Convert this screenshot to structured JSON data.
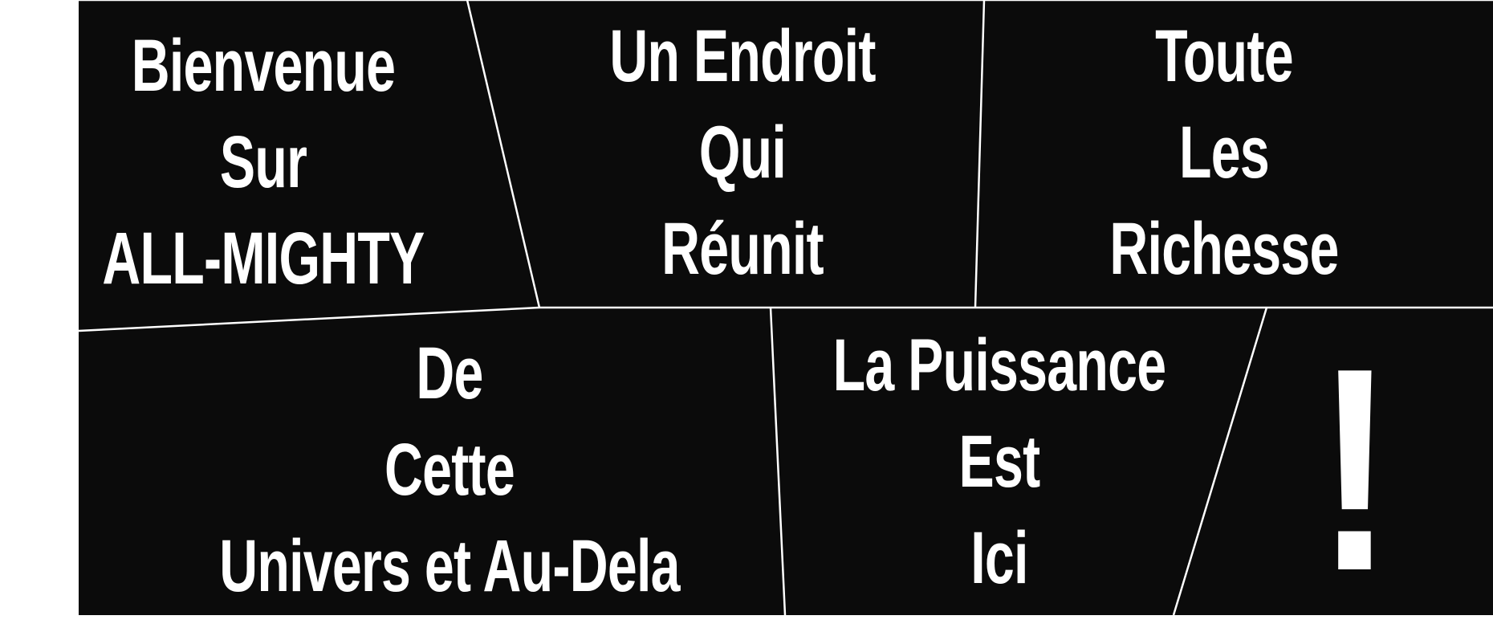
{
  "colors": {
    "background": "#0b0b0b",
    "text": "#ffffff",
    "divider": "#ffffff"
  },
  "panels": [
    {
      "lines": [
        "Bienvenue",
        "Sur",
        "ALL-MIGHTY"
      ]
    },
    {
      "lines": [
        "Un Endroit",
        "Qui",
        "Réunit"
      ]
    },
    {
      "lines": [
        "Toute",
        "Les",
        "Richesse"
      ]
    },
    {
      "lines": [
        "De",
        "Cette",
        "Univers et Au-Dela"
      ]
    },
    {
      "lines": [
        "La Puissance",
        "Est",
        "Ici"
      ]
    },
    {
      "lines": [
        "!"
      ]
    }
  ]
}
